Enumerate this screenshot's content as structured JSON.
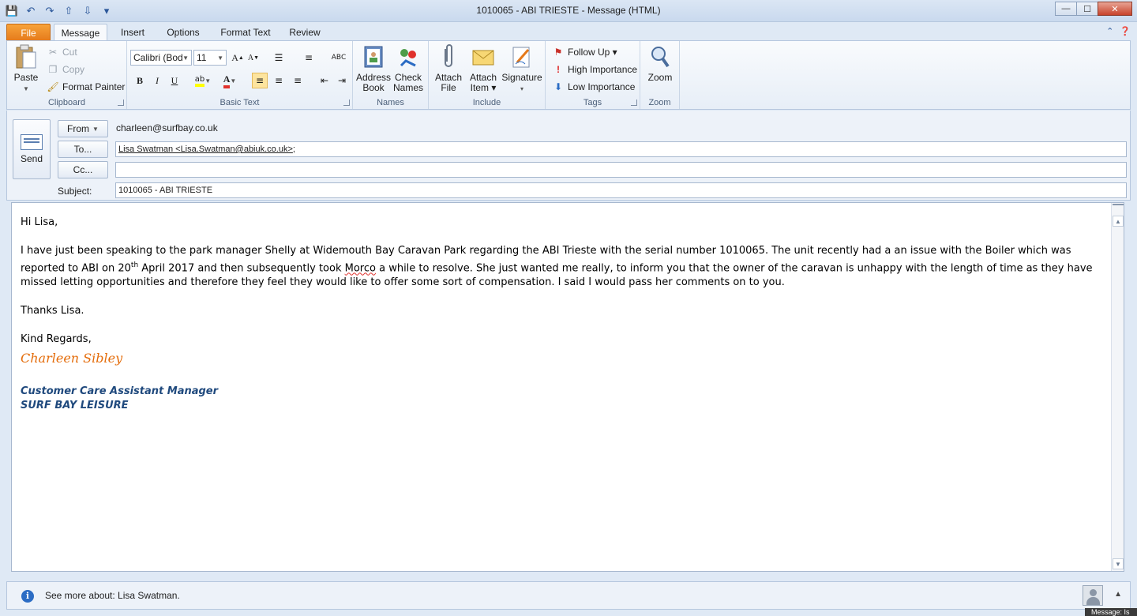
{
  "window": {
    "title": "1010065 - ABI TRIESTE  -  Message (HTML)",
    "min_label": "—",
    "max_label": "☐",
    "close_label": "✕"
  },
  "quick_access": [
    "💾",
    "↶",
    "↷",
    "⇧",
    "⇩",
    "▾"
  ],
  "tabs": {
    "file": "File",
    "message": "Message",
    "insert": "Insert",
    "options": "Options",
    "format_text": "Format Text",
    "review": "Review"
  },
  "ribbon": {
    "clipboard": {
      "label": "Clipboard",
      "paste": "Paste",
      "cut": "Cut",
      "copy": "Copy",
      "format_painter": "Format Painter"
    },
    "basic_text": {
      "label": "Basic Text",
      "font": "Calibri (Body)",
      "size": "11",
      "bold": "B",
      "italic": "I",
      "underline": "U"
    },
    "names": {
      "label": "Names",
      "address_book": [
        "Address",
        "Book"
      ],
      "check_names": [
        "Check",
        "Names"
      ]
    },
    "include": {
      "label": "Include",
      "attach_file": [
        "Attach",
        "File"
      ],
      "attach_item": [
        "Attach",
        "Item ▾"
      ],
      "signature": [
        "Signature",
        "▾"
      ]
    },
    "tags": {
      "label": "Tags",
      "follow_up": "Follow Up ▾",
      "high_importance": "High Importance",
      "low_importance": "Low Importance"
    },
    "zoom": {
      "label": "Zoom",
      "zoom": "Zoom"
    }
  },
  "header": {
    "send": "Send",
    "from_btn": "From",
    "from_value": "charleen@surfbay.co.uk",
    "to_btn": "To...",
    "to_value": "Lisa Swatman <Lisa.Swatman@abiuk.co.uk>",
    "to_suffix": ";",
    "cc_btn": "Cc...",
    "cc_value": "",
    "subject_label": "Subject:",
    "subject_value": "1010065 - ABI TRIESTE"
  },
  "body": {
    "greeting": "Hi Lisa,",
    "p1_a": "I have just been speaking to the park manager Shelly at Widemouth Bay Caravan Park regarding the ABI Trieste with the serial number 1010065.  The unit recently had a an issue with the Boiler which was reported to ABI on 20",
    "p1_sup": "th",
    "p1_b": " April 2017 and then subsequently took ",
    "p1_misspelled": "Morco",
    "p1_c": " a while to resolve.  She just wanted me really, to inform you that the owner of the caravan is unhappy with the length of time as they have missed letting opportunities and therefore they feel they would like to offer some sort of compensation.  I said I would pass her comments on to you.",
    "thanks": "Thanks Lisa.",
    "regards": "Kind Regards,",
    "sig_name": "Charleen Sibley",
    "sig_title": "Customer Care Assistant Manager",
    "sig_company": "SURF BAY LEISURE"
  },
  "footer": {
    "info": "i",
    "see_more": "See more about: Lisa Swatman.",
    "collapse": "▲",
    "taskbar_tip": "Message: Is"
  }
}
